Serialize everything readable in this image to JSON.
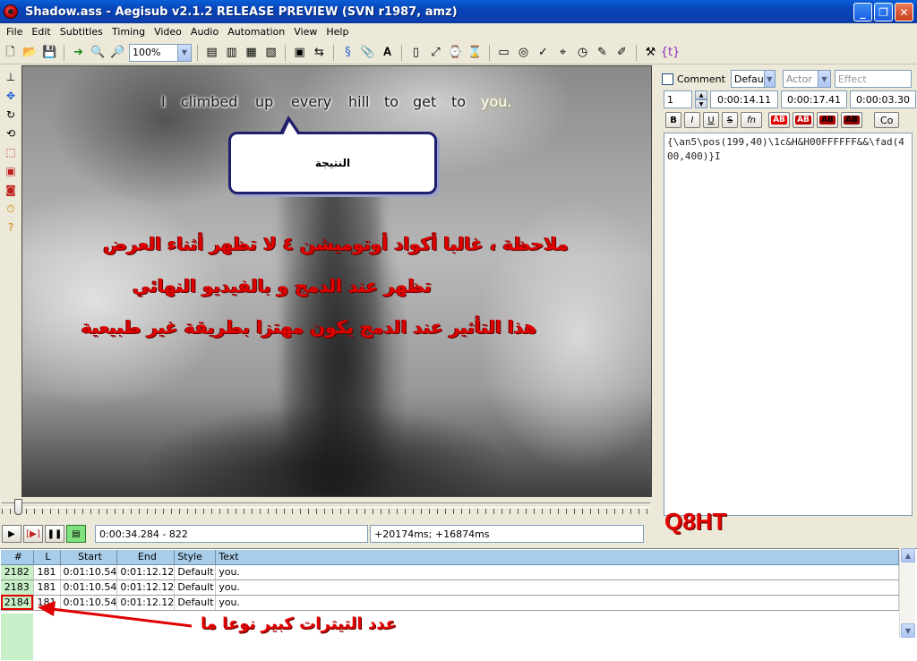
{
  "window": {
    "title": "Shadow.ass - Aegisub v2.1.2 RELEASE PREVIEW (SVN r1987, amz)"
  },
  "menu": [
    "File",
    "Edit",
    "Subtitles",
    "Timing",
    "Video",
    "Audio",
    "Automation",
    "View",
    "Help"
  ],
  "toolbar": {
    "zoom": "100%"
  },
  "video": {
    "karaoke_words": [
      "I",
      "climbed",
      "up",
      "every",
      "hill",
      "to",
      "get",
      "to",
      "you."
    ],
    "highlighted_word": "you.",
    "callout_text": "النتيجة",
    "note_lines": [
      "ملاحظة ، غالبا أكواد أوتوميشن ٤ لا تظهر أثناء العرض",
      "تظهر عند الدمج و بالفيديو النهائي",
      "هذا التأثير عند الدمج يكون مهتزا بطريقة غير طبيعية"
    ]
  },
  "playback": {
    "time_frame": "0:00:34.284 - 822",
    "offsets": "+20174ms; +16874ms"
  },
  "edit_panel": {
    "comment_label": "Comment",
    "style": "Defau",
    "actor_placeholder": "Actor",
    "effect_placeholder": "Effect",
    "layer": "1",
    "start_time": "0:00:14.11",
    "end_time": "0:00:17.41",
    "duration": "0:00:03.30",
    "format_buttons": [
      "B",
      "I",
      "U",
      "S",
      "fn"
    ],
    "commit_label": "Co",
    "text": "{\\an5\\pos(199,40)\\1c&H&H00FFFFFF&&\\fad(400,400)}I"
  },
  "watermark": "Q8HT",
  "grid": {
    "headers": [
      "#",
      "L",
      "Start",
      "End",
      "Style",
      "Text"
    ],
    "rows": [
      [
        "2182",
        "181",
        "0:01:10.54",
        "0:01:12.12",
        "Default",
        "you."
      ],
      [
        "2183",
        "181",
        "0:01:10.54",
        "0:01:12.12",
        "Default",
        "you."
      ],
      [
        "2184",
        "181",
        "0:01:10.54",
        "0:01:12.12",
        "Default",
        "you."
      ]
    ]
  },
  "annotation": "عدد التيترات كبير نوعا ما",
  "colors": {
    "accent_red": "#e00000",
    "grid_header": "#a8cdea",
    "row_number_bg": "#c8f0c8"
  }
}
